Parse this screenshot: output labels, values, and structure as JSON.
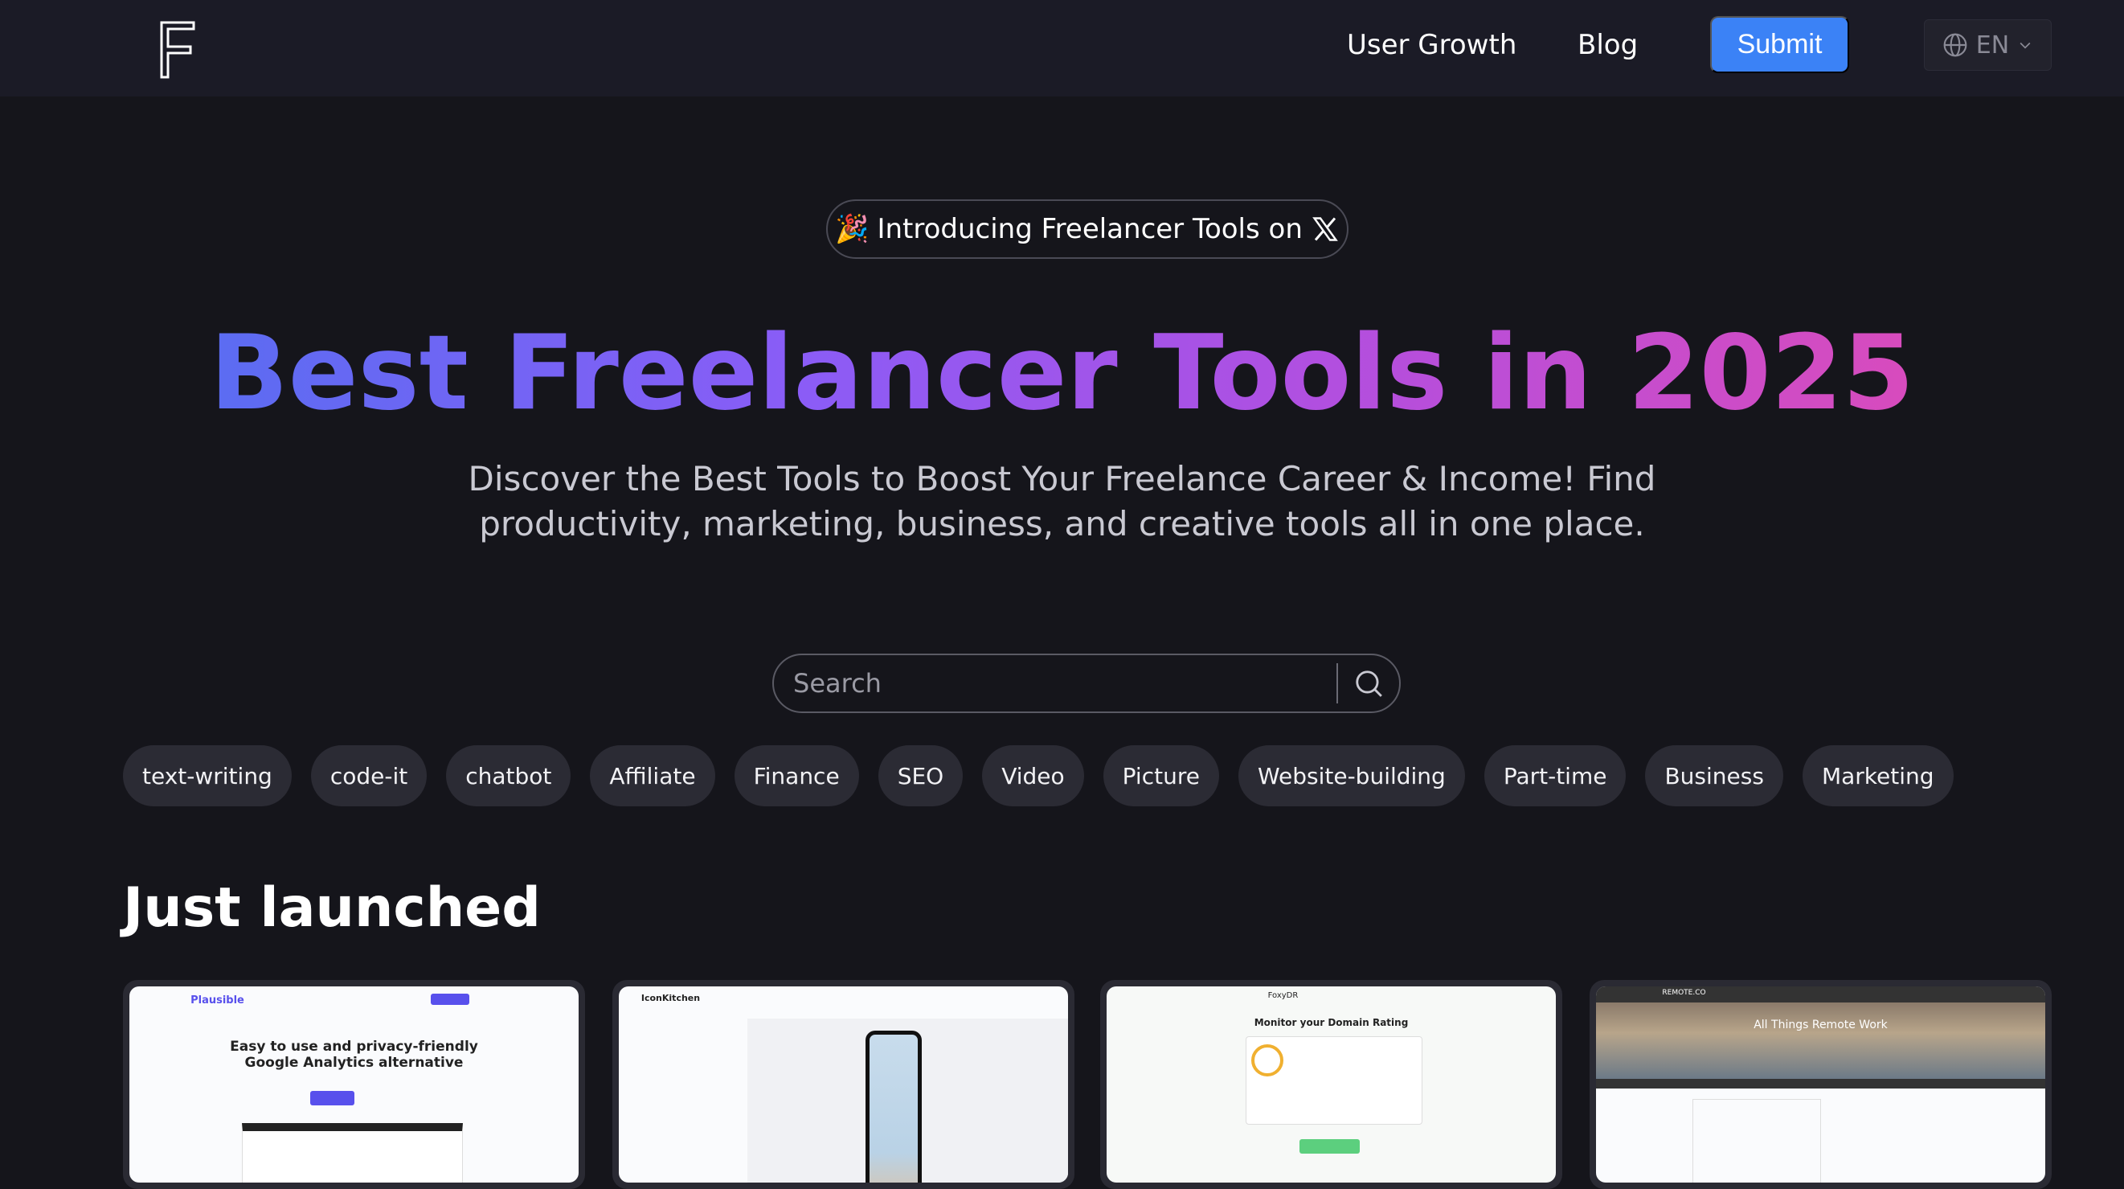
{
  "header": {
    "logo": "F",
    "nav": [
      {
        "label": "User Growth"
      },
      {
        "label": "Blog"
      }
    ],
    "submit_label": "Submit",
    "language": "EN"
  },
  "hero": {
    "badge_text": "Introducing Freelancer Tools on",
    "badge_icon": "x-logo-icon",
    "title": "Best Freelancer Tools in 2025",
    "subtitle_line1": "Discover the Best Tools to Boost Your Freelance Career & Income! Find",
    "subtitle_line2": "productivity, marketing, business, and creative tools all in one place."
  },
  "search": {
    "placeholder": "Search"
  },
  "tags": [
    "text-writing",
    "code-it",
    "chatbot",
    "Affiliate",
    "Finance",
    "SEO",
    "Video",
    "Picture",
    "Website-building",
    "Part-time",
    "Business",
    "Marketing"
  ],
  "section_title": "Just launched",
  "cards": [
    {
      "brand": "Plausible",
      "headline": "Easy to use and privacy-friendly Google Analytics alternative"
    },
    {
      "brand": "IconKitchen",
      "headline": ""
    },
    {
      "brand": "FoxyDR",
      "headline": "Monitor your Domain Rating"
    },
    {
      "brand": "REMOTE.CO",
      "headline": "All Things Remote Work"
    }
  ],
  "colors": {
    "header_bg": "#1b1b26",
    "page_bg": "#15151b",
    "accent": "#3b82f6",
    "gradient_start": "#5b6cf2",
    "gradient_end": "#d84bbd",
    "tag_bg": "#2b2b34"
  }
}
